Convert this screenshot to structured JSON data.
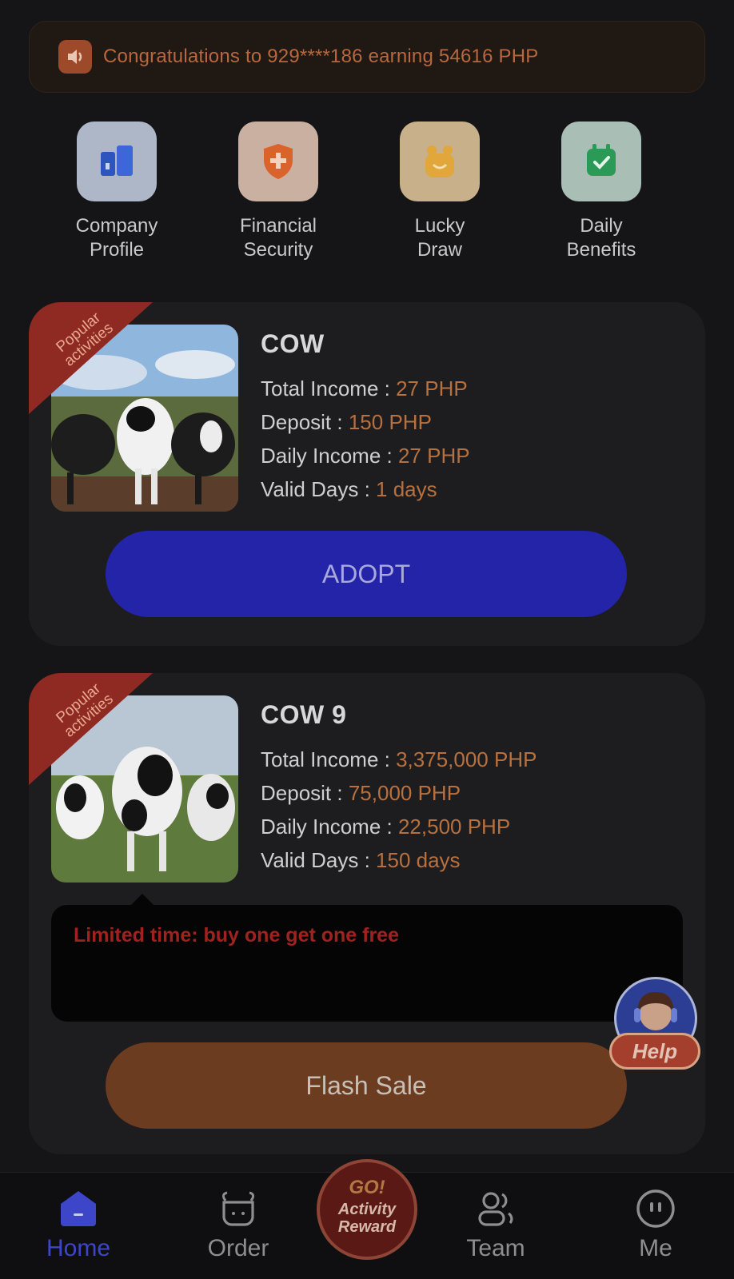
{
  "notice": {
    "text": "Congratulations to 929****186 earning 54616 PHP",
    "icon": "speaker-icon"
  },
  "quick_menu": [
    {
      "label": "Company\nProfile",
      "icon": "building-icon",
      "color": "#2f57c4"
    },
    {
      "label": "Financial\nSecurity",
      "icon": "shield-plus-icon",
      "color": "#d9632b"
    },
    {
      "label": "Lucky\nDraw",
      "icon": "gift-bag-icon",
      "color": "#e1a73a"
    },
    {
      "label": "Daily\nBenefits",
      "icon": "calendar-check-icon",
      "color": "#2b9a57"
    }
  ],
  "products": [
    {
      "ribbon": "Popular\nactivities",
      "name": "COW",
      "total_income_label": "Total Income :",
      "total_income": "27 PHP",
      "deposit_label": "Deposit :",
      "deposit": "150 PHP",
      "daily_income_label": "Daily Income :",
      "daily_income": "27 PHP",
      "valid_days_label": "Valid Days :",
      "valid_days": "1 days",
      "button": "ADOPT"
    },
    {
      "ribbon": "Popular\nactivities",
      "name": "COW 9",
      "total_income_label": "Total Income :",
      "total_income": "3,375,000 PHP",
      "deposit_label": "Deposit :",
      "deposit": "75,000 PHP",
      "daily_income_label": "Daily Income :",
      "daily_income": "22,500 PHP",
      "valid_days_label": "Valid Days :",
      "valid_days": "150 days",
      "promo": "Limited time: buy one get one free",
      "button": "Flash Sale"
    }
  ],
  "help": {
    "label": "Help"
  },
  "nav": {
    "home": "Home",
    "order": "Order",
    "center_go": "GO!",
    "center_label": "Activity\nReward",
    "team": "Team",
    "me": "Me"
  },
  "colors": {
    "accent_blue": "#2424a8",
    "value_orange": "#b7713f",
    "flash_brown": "#6b3c1f",
    "promo_red": "#a0221e"
  }
}
